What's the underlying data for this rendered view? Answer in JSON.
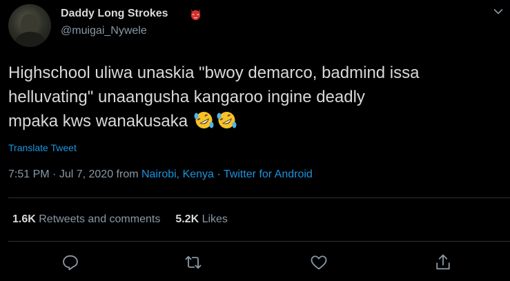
{
  "user": {
    "display_name": "Daddy Long Strokes",
    "handle": "@muigai_Nywele",
    "badge_icon": "devil-mask-emoji"
  },
  "tweet": {
    "text_line_1": "Highschool uliwa unaskia \"bwoy demarco, badmind issa",
    "text_line_2": "helluvating\" unaangusha kangaroo ingine deadly",
    "text_line_3": "mpaka kws wanakusaka",
    "emojis": [
      "rolling-on-floor-laughing-emoji",
      "rolling-on-floor-laughing-emoji"
    ],
    "translate_label": "Translate Tweet"
  },
  "meta": {
    "time": "7:51 PM",
    "separator": " · ",
    "date": "Jul 7, 2020",
    "from_label": " from ",
    "location": "Nairobi, Kenya",
    "source": "Twitter for Android"
  },
  "stats": {
    "retweets_count": "1.6K",
    "retweets_label": "Retweets and comments",
    "likes_count": "5.2K",
    "likes_label": "Likes"
  },
  "actions": [
    "reply-icon",
    "retweet-icon",
    "like-icon",
    "share-icon"
  ],
  "colors": {
    "background": "#000000",
    "text": "#d9d9d9",
    "secondary": "#8899a6",
    "link": "#1b95e0",
    "divider": "#2f3336"
  }
}
